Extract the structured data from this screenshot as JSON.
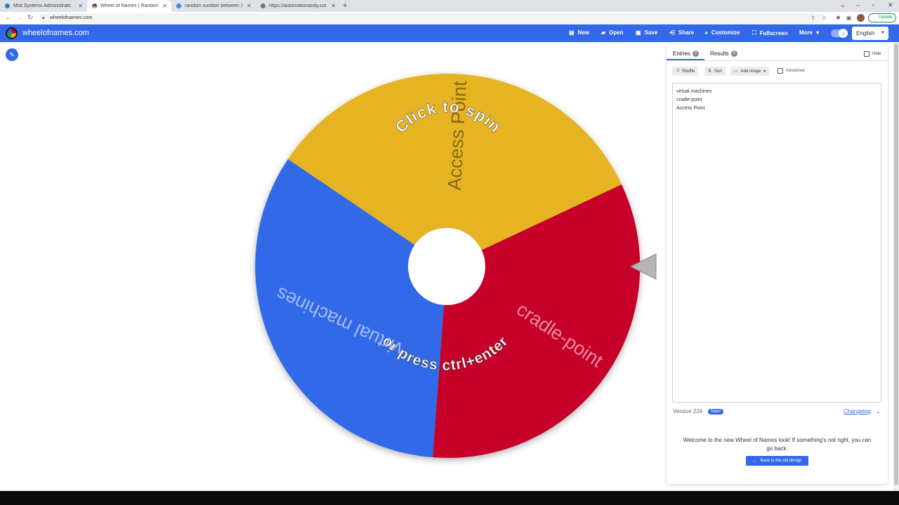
{
  "browser": {
    "tabs": [
      {
        "label": "Mist Systems Administration",
        "color": "#2e7bcf"
      },
      {
        "label": "Wheel of Names | Random name",
        "color": "#3369e8"
      },
      {
        "label": "random number between 1 and",
        "color": "#4285f4"
      },
      {
        "label": "https://automationandy.com/bro",
        "color": "#777777"
      }
    ],
    "url": "wheelofnames.com",
    "update_label": "Update"
  },
  "app": {
    "brand": "wheelofnames.com",
    "menu": {
      "new_label": "New",
      "open_label": "Open",
      "save_label": "Save",
      "share_label": "Share",
      "customize_label": "Customize",
      "fullscreen_label": "Fullscreen",
      "more_label": "More"
    },
    "language": "English",
    "accent_color": "#3369e8"
  },
  "wheel": {
    "segments": [
      {
        "label": "Access Point",
        "color": "#e6b420"
      },
      {
        "label": "cradle-point",
        "color": "#c7002a"
      },
      {
        "label": "virtual machines",
        "color": "#3369e8"
      }
    ],
    "hint_top": "Click to spin",
    "hint_bottom": "or press ctrl+enter"
  },
  "panel": {
    "entries_tab": "Entries",
    "entries_count": "3",
    "results_tab": "Results",
    "results_count": "0",
    "hide_label": "Hide",
    "shuffle_label": "Shuffle",
    "sort_label": "Sort",
    "add_image_label": "Add image",
    "advanced_label": "Advanced",
    "entries": [
      "virtual machines",
      "cradle-point",
      "Access Point"
    ],
    "version_label": "Version 224",
    "new_badge": "New!",
    "changelog_label": "Changelog",
    "welcome_text": "Welcome to the new Wheel of Names look! If something's not right, you can go back.",
    "back_button_label": "Back to the old design"
  }
}
